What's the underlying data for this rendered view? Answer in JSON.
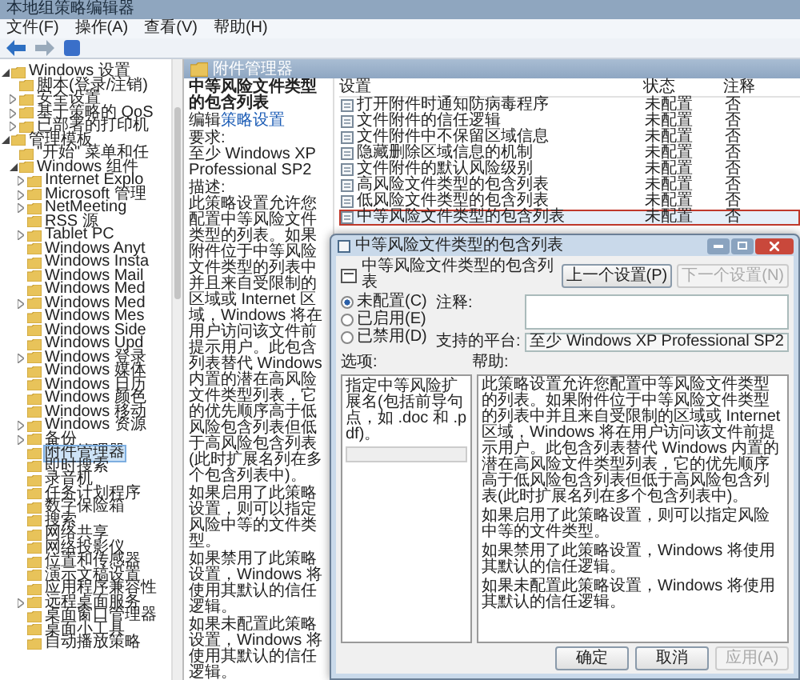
{
  "window": {
    "title": "本地组策略编辑器"
  },
  "menu": [
    "文件(F)",
    "操作(A)",
    "查看(V)",
    "帮助(H)"
  ],
  "tree": [
    {
      "label": "Windows 设置",
      "selected": false,
      "expanded": true,
      "children": [
        {
          "label": "脚本(登录/注销)",
          "selected": false
        },
        {
          "label": "安全设置",
          "selected": false,
          "expanded": false
        },
        {
          "label": "基于策略的 QoS",
          "selected": false,
          "expanded": false
        },
        {
          "label": "已部署的打印机",
          "selected": false,
          "expanded": false
        }
      ]
    },
    {
      "label": "管理模板",
      "selected": false,
      "expanded": true,
      "children": [
        {
          "label": "\"开始\" 菜单和任",
          "selected": false
        },
        {
          "label": "Windows 组件",
          "selected": false,
          "expanded": true,
          "children": [
            {
              "label": "Internet Explo",
              "selected": false,
              "expanded": false
            },
            {
              "label": "Microsoft 管理",
              "selected": false,
              "expanded": false
            },
            {
              "label": "NetMeeting",
              "selected": false,
              "expanded": false
            },
            {
              "label": "RSS 源",
              "selected": false
            },
            {
              "label": "Tablet PC",
              "selected": false,
              "expanded": false
            },
            {
              "label": "Windows Anyt",
              "selected": false
            },
            {
              "label": "Windows Insta",
              "selected": false
            },
            {
              "label": "Windows Mail",
              "selected": false
            },
            {
              "label": "Windows Med",
              "selected": false
            },
            {
              "label": "Windows Med",
              "selected": false,
              "expanded": false
            },
            {
              "label": "Windows Mes",
              "selected": false
            },
            {
              "label": "Windows Side",
              "selected": false
            },
            {
              "label": "Windows Upd",
              "selected": false
            },
            {
              "label": "Windows 登录",
              "selected": false,
              "expanded": false
            },
            {
              "label": "Windows 媒体",
              "selected": false
            },
            {
              "label": "Windows 日历",
              "selected": false
            },
            {
              "label": "Windows 颜色",
              "selected": false
            },
            {
              "label": "Windows 移动",
              "selected": false
            },
            {
              "label": "Windows 资源",
              "selected": false,
              "expanded": false
            },
            {
              "label": "备份",
              "selected": false,
              "expanded": false
            },
            {
              "label": "附件管理器",
              "selected": true
            },
            {
              "label": "即时搜索",
              "selected": false
            },
            {
              "label": "录音机",
              "selected": false
            },
            {
              "label": "任务计划程序",
              "selected": false
            },
            {
              "label": "数字保险箱",
              "selected": false
            },
            {
              "label": "搜索",
              "selected": false
            },
            {
              "label": "网络共享",
              "selected": false
            },
            {
              "label": "网络投影仪",
              "selected": false
            },
            {
              "label": "位置和传感器",
              "selected": false
            },
            {
              "label": "演示文稿设置",
              "selected": false
            },
            {
              "label": "应用程序兼容性",
              "selected": false
            },
            {
              "label": "远程桌面服务",
              "selected": false,
              "expanded": false
            },
            {
              "label": "桌面窗口管理器",
              "selected": false
            },
            {
              "label": "桌面小工具",
              "selected": false
            },
            {
              "label": "自动播放策略",
              "selected": false
            }
          ]
        }
      ]
    }
  ],
  "detail": {
    "header": "附件管理器",
    "title": "中等风险文件类型的包含列表",
    "edit_text": "编辑",
    "edit_link": "策略设置",
    "requirement_label": "要求:",
    "requirement": "至少 Windows XP Professional SP2",
    "description_label": "描述:",
    "paragraphs": [
      "此策略设置允许您配置中等风险文件类型的列表。如果附件位于中等风险文件类型的列表中并且来自受限制的区域或 Internet 区域，Windows 将在用户访问该文件前提示用户。此包含列表替代 Windows 内置的潜在高风险文件类型列表，它的优先顺序高于低风险包含列表但低于高风险包含列表(此时扩展名列在多个包含列表中)。",
      "如果启用了此策略设置，则可以指定风险中等的文件类型。",
      "如果禁用了此策略设置，Windows 将使用其默认的信任逻辑。",
      "如果未配置此策略设置，Windows 将使用其默认的信任逻辑。"
    ]
  },
  "list": {
    "columns": [
      "设置",
      "状态",
      "注释"
    ],
    "rows": [
      {
        "setting": "打开附件时通知防病毒程序",
        "state": "未配置",
        "comment": "否",
        "selected": false
      },
      {
        "setting": "文件附件的信任逻辑",
        "state": "未配置",
        "comment": "否",
        "selected": false
      },
      {
        "setting": "文件附件中不保留区域信息",
        "state": "未配置",
        "comment": "否",
        "selected": false
      },
      {
        "setting": "隐藏删除区域信息的机制",
        "state": "未配置",
        "comment": "否",
        "selected": false
      },
      {
        "setting": "文件附件的默认风险级别",
        "state": "未配置",
        "comment": "否",
        "selected": false
      },
      {
        "setting": "高风险文件类型的包含列表",
        "state": "未配置",
        "comment": "否",
        "selected": false
      },
      {
        "setting": "低风险文件类型的包含列表",
        "state": "未配置",
        "comment": "否",
        "selected": false
      },
      {
        "setting": "中等风险文件类型的包含列表",
        "state": "未配置",
        "comment": "否",
        "selected": true
      }
    ]
  },
  "dialog": {
    "title": "中等风险文件类型的包含列表",
    "heading": "中等风险文件类型的包含列表",
    "nav_buttons": [
      {
        "label": "上一个设置(P)",
        "disabled": false
      },
      {
        "label": "下一个设置(N)",
        "disabled": true
      }
    ],
    "radios": [
      {
        "label": "未配置(C)",
        "selected": true
      },
      {
        "label": "已启用(E)",
        "selected": false
      },
      {
        "label": "已禁用(D)",
        "selected": false
      }
    ],
    "comment_label": "注释:",
    "platform_label": "支持的平台:",
    "platform": "至少 Windows XP Professional SP2",
    "options_label": "选项:",
    "help_label": "帮助:",
    "option_text": "指定中等风险扩展名(包括前导句点，如 .doc 和 .pdf)。",
    "option_field": {
      "disabled": true
    },
    "help": [
      "此策略设置允许您配置中等风险文件类型的列表。如果附件位于中等风险文件类型的列表中并且来自受限制的区域或 Internet 区域，Windows 将在用户访问该文件前提示用户。此包含列表替代 Windows 内置的潜在高风险文件类型列表，它的优先顺序高于低风险包含列表但低于高风险包含列表(此时扩展名列在多个包含列表中)。",
      "如果启用了此策略设置，则可以指定风险中等的文件类型。",
      "如果禁用了此策略设置，Windows 将使用其默认的信任逻辑。",
      "如果未配置此策略设置，Windows 将使用其默认的信任逻辑。"
    ],
    "buttons": [
      {
        "label": "确定",
        "disabled": false
      },
      {
        "label": "取消",
        "disabled": false
      },
      {
        "label": "应用(A)",
        "disabled": true
      }
    ]
  }
}
